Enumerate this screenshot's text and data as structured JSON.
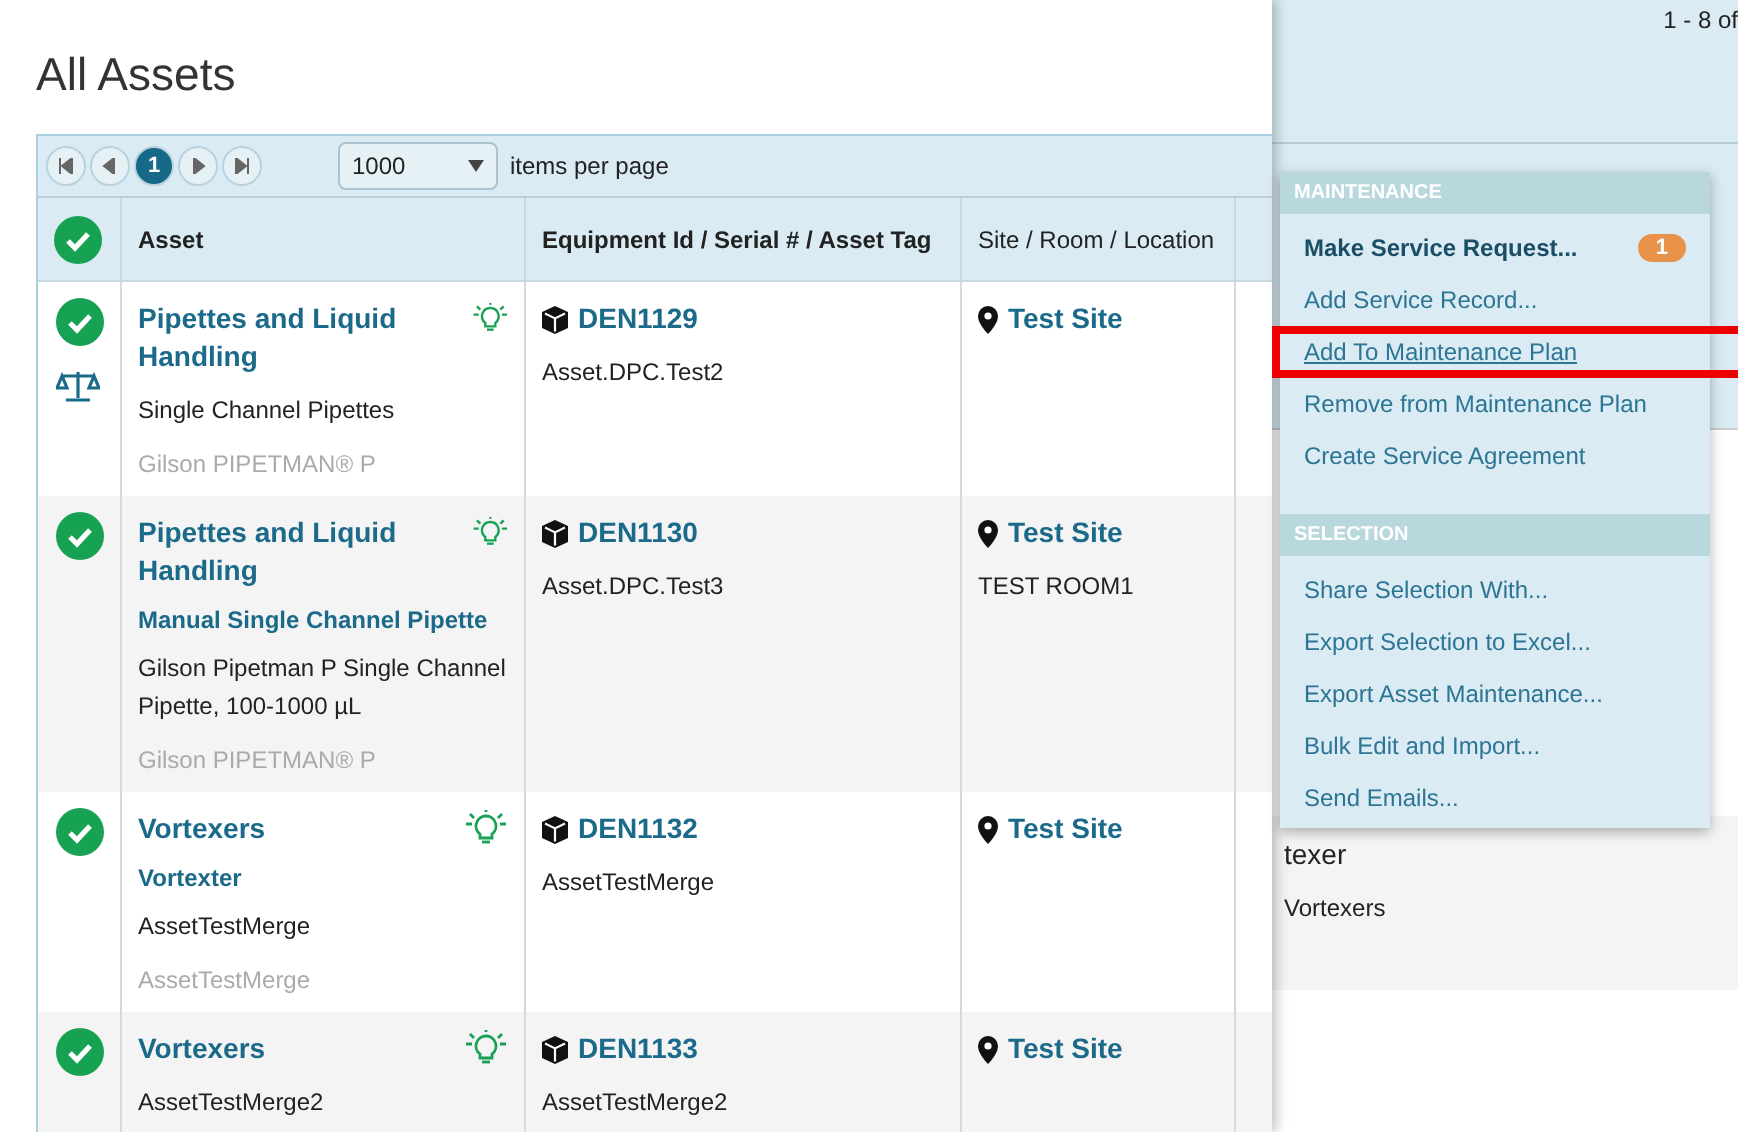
{
  "title": "All Assets",
  "pager": {
    "pages": [
      {
        "label": "1",
        "selected": true
      }
    ],
    "page_size": "1000",
    "page_size_label": "items per page"
  },
  "table": {
    "all_checked": true,
    "columns": [
      {
        "label": "Asset",
        "bold": true
      },
      {
        "label": "Equipment Id / Serial # / Asset Tag",
        "bold": true
      },
      {
        "label": "Site / Room / Location",
        "bold": false
      }
    ],
    "rows": [
      {
        "checked": true,
        "calibrated": true,
        "name": "Pipettes and Liquid Handling",
        "model": "",
        "description": "Single Channel Pipettes",
        "manufacturer": "Gilson PIPETMAN® P",
        "equipment_id": "DEN1129",
        "serial": "Asset.DPC.Test2",
        "site": "Test Site",
        "room": ""
      },
      {
        "checked": true,
        "calibrated": false,
        "name": "Pipettes and Liquid Handling",
        "model": "Manual Single Channel Pipette",
        "description": "Gilson Pipetman P Single Channel Pipette, 100-1000 µL",
        "manufacturer": "Gilson PIPETMAN® P",
        "equipment_id": "DEN1130",
        "serial": "Asset.DPC.Test3",
        "site": "Test Site",
        "room": "TEST ROOM1"
      },
      {
        "checked": true,
        "calibrated": false,
        "name": "Vortexers",
        "model": "Vortexter",
        "description": "AssetTestMerge",
        "manufacturer": "AssetTestMerge",
        "equipment_id": "DEN1132",
        "serial": "AssetTestMerge",
        "site": "Test Site",
        "room": ""
      },
      {
        "checked": true,
        "calibrated": false,
        "name": "Vortexers",
        "model": "",
        "description": "AssetTestMerge2",
        "manufacturer": "",
        "equipment_id": "DEN1133",
        "serial": "AssetTestMerge2",
        "site": "Test Site",
        "room": ""
      }
    ]
  },
  "background": {
    "range": "1 - 8 of",
    "row_texts": [
      "texer",
      "Vortexers"
    ]
  },
  "menu": {
    "sections": [
      {
        "title": "MAINTENANCE",
        "items": [
          {
            "label": "Make Service Request...",
            "emphasized": true,
            "badge": "1",
            "highlighted": false
          },
          {
            "label": "Add Service Record...",
            "emphasized": false,
            "highlighted": false
          },
          {
            "label": "Add To Maintenance Plan",
            "emphasized": false,
            "highlighted": true
          },
          {
            "label": "Remove from Maintenance Plan",
            "emphasized": false,
            "highlighted": false
          },
          {
            "label": "Create Service Agreement",
            "emphasized": false,
            "highlighted": false
          }
        ]
      },
      {
        "title": "SELECTION",
        "items": [
          {
            "label": "Share Selection With...",
            "emphasized": false,
            "highlighted": false
          },
          {
            "label": "Export Selection to Excel...",
            "emphasized": false,
            "highlighted": false
          },
          {
            "label": "Export Asset Maintenance...",
            "emphasized": false,
            "highlighted": false
          },
          {
            "label": "Bulk Edit and Import...",
            "emphasized": false,
            "highlighted": false
          },
          {
            "label": "Send Emails...",
            "emphasized": false,
            "highlighted": false
          }
        ]
      }
    ]
  }
}
